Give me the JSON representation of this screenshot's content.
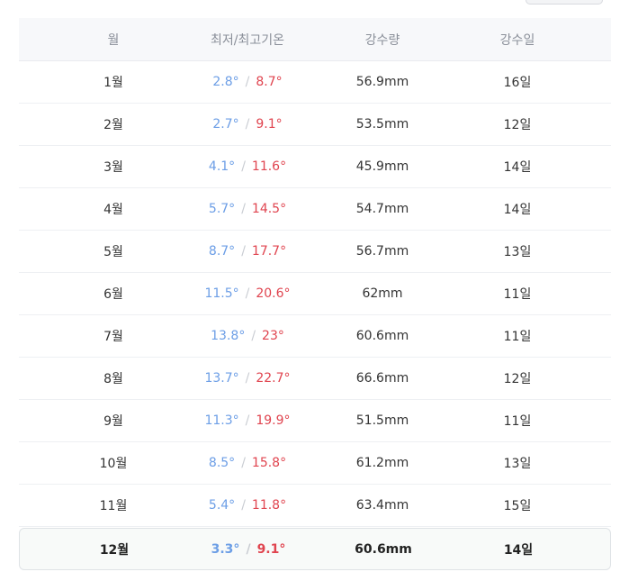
{
  "header": {
    "month": "월",
    "temperature": "최저/최고기온",
    "precipitation": "강수량",
    "rain_days": "강수일"
  },
  "temperature_separator": "/",
  "rows": [
    {
      "month": "1월",
      "low": "2.8°",
      "high": "8.7°",
      "precip": "56.9mm",
      "days": "16일"
    },
    {
      "month": "2월",
      "low": "2.7°",
      "high": "9.1°",
      "precip": "53.5mm",
      "days": "12일"
    },
    {
      "month": "3월",
      "low": "4.1°",
      "high": "11.6°",
      "precip": "45.9mm",
      "days": "14일"
    },
    {
      "month": "4월",
      "low": "5.7°",
      "high": "14.5°",
      "precip": "54.7mm",
      "days": "14일"
    },
    {
      "month": "5월",
      "low": "8.7°",
      "high": "17.7°",
      "precip": "56.7mm",
      "days": "13일"
    },
    {
      "month": "6월",
      "low": "11.5°",
      "high": "20.6°",
      "precip": "62mm",
      "days": "11일"
    },
    {
      "month": "7월",
      "low": "13.8°",
      "high": "23°",
      "precip": "60.6mm",
      "days": "11일"
    },
    {
      "month": "8월",
      "low": "13.7°",
      "high": "22.7°",
      "precip": "66.6mm",
      "days": "12일"
    },
    {
      "month": "9월",
      "low": "11.3°",
      "high": "19.9°",
      "precip": "51.5mm",
      "days": "11일"
    },
    {
      "month": "10월",
      "low": "8.5°",
      "high": "15.8°",
      "precip": "61.2mm",
      "days": "13일"
    },
    {
      "month": "11월",
      "low": "5.4°",
      "high": "11.8°",
      "precip": "63.4mm",
      "days": "15일"
    },
    {
      "month": "12월",
      "low": "3.3°",
      "high": "9.1°",
      "precip": "60.6mm",
      "days": "14일",
      "current": true
    }
  ],
  "colors": {
    "low_temp": "#6c9ee6",
    "high_temp": "#e0444f",
    "header_text": "#8a8f99",
    "header_bg": "#f7f8fa",
    "highlight_bg": "#f8faf9"
  }
}
